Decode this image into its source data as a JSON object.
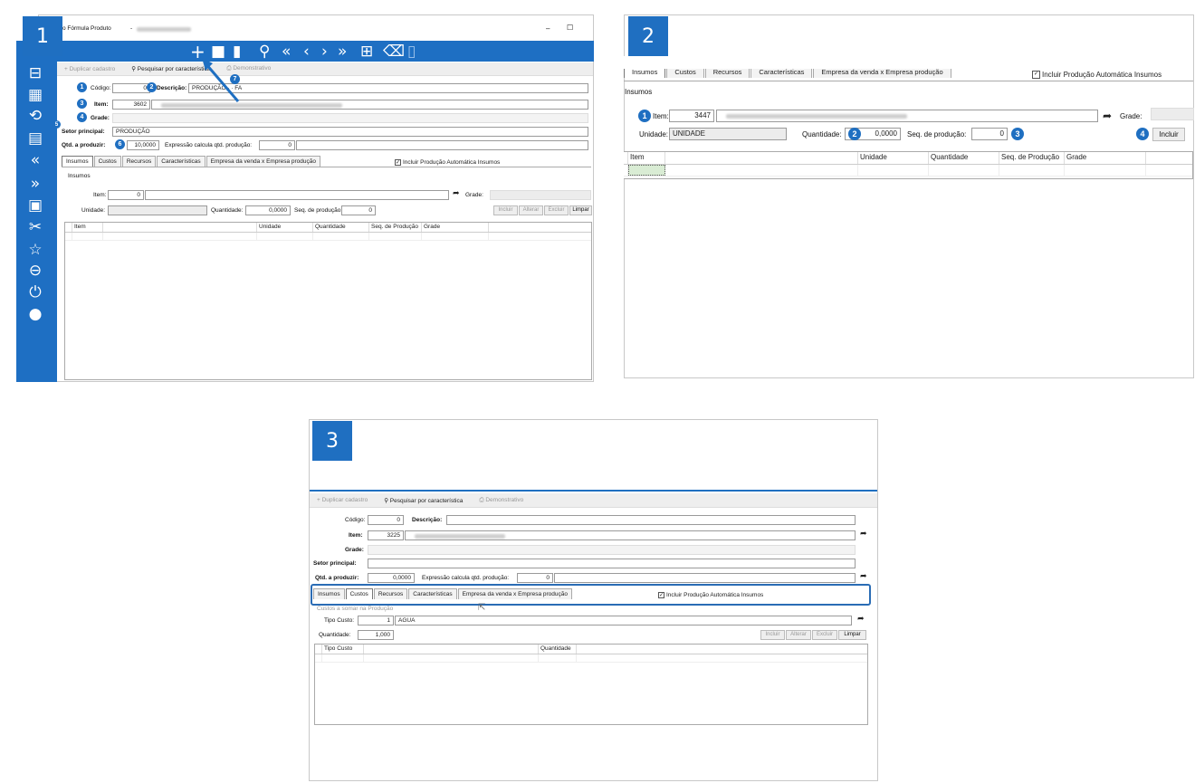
{
  "panels": [
    {
      "number": "1"
    },
    {
      "number": "2"
    },
    {
      "number": "3"
    }
  ],
  "p1": {
    "window_title": "tro Fórmula Produto",
    "title_sep": "-",
    "minimize": "–",
    "maximize": "☐",
    "subbar": {
      "duplicate": "Duplicar cadastro",
      "search": "Pesquisar por característica",
      "demo": "Demonstrativo"
    },
    "codigo_label": "Código:",
    "codigo_value": "0",
    "descricao_label": "Descrição:",
    "descricao_value": "PRODUÇÃO · · FA",
    "item_label": "Item:",
    "item_value": "3602",
    "grade_label": "Grade:",
    "setor_label": "Setor principal:",
    "setor_value": "PRODUÇÃO",
    "qtd_label": "Qtd. a produzir:",
    "qtd_value": "10,0000",
    "expr_label": "Expressão calcula qtd. produção:",
    "expr_value": "0",
    "tabs": [
      "Insumos",
      "Custos",
      "Recursos",
      "Características",
      "Empresa da venda x Empresa produção"
    ],
    "checkbox_label": "Incluir Produção Automática Insumos",
    "section_label": "Insumos",
    "ins_item_label": "Item:",
    "ins_item_value": "0",
    "ins_grade_label": "Grade:",
    "ins_unidade_label": "Unidade:",
    "ins_qtd_label": "Quantidade:",
    "ins_qtd_value": "0,0000",
    "ins_seq_label": "Seq. de produção:",
    "ins_seq_value": "0",
    "buttons": {
      "incluir": "Incluir",
      "alterar": "Alterar",
      "excluir": "Excluir",
      "limpar": "Limpar"
    },
    "grid_headers": [
      "Item",
      "Unidade",
      "Quantidade",
      "Seq. de Produção",
      "Grade"
    ],
    "callouts": [
      "1",
      "2",
      "3",
      "4",
      "5",
      "6",
      "7"
    ]
  },
  "p2": {
    "tabs": [
      "Insumos",
      "Custos",
      "Recursos",
      "Características",
      "Empresa da venda x Empresa produção"
    ],
    "checkbox_label": "Incluir Produção Automática Insumos",
    "section_label": "Insumos",
    "item_label": "Item:",
    "item_value": "3447",
    "grade_label": "Grade:",
    "unidade_label": "Unidade:",
    "unidade_value": "UNIDADE",
    "qtd_label": "Quantidade:",
    "qtd_value": "0,0000",
    "seq_label": "Seq. de produção:",
    "seq_value": "0",
    "incluir": "Incluir",
    "grid_headers": [
      "Item",
      "Unidade",
      "Quantidade",
      "Seq. de Produção",
      "Grade"
    ],
    "callouts": [
      "1",
      "2",
      "3",
      "4"
    ]
  },
  "p3": {
    "subbar": {
      "duplicate": "Duplicar cadastro",
      "search": "Pesquisar por característica",
      "demo": "Demonstrativo"
    },
    "codigo_label": "Código:",
    "codigo_value": "0",
    "descricao_label": "Descrição:",
    "item_label": "Item:",
    "item_value": "3225",
    "grade_label": "Grade:",
    "setor_label": "Setor principal:",
    "qtd_label": "Qtd. a produzir:",
    "qtd_value": "0,0000",
    "expr_label": "Expressão calcula qtd. produção:",
    "expr_value": "0",
    "tabs": [
      "Insumos",
      "Custos",
      "Recursos",
      "Características",
      "Empresa da venda x Empresa produção"
    ],
    "checkbox_label": "Incluir Produção Automática Insumos",
    "section_label": "Custos a somar na Produção",
    "tipo_label": "Tipo Custo:",
    "tipo_value": "1",
    "tipo_desc": "AGUA",
    "quantidade_label": "Quantidade:",
    "quantidade_value": "1,000",
    "buttons": {
      "incluir": "Incluir",
      "alterar": "Alterar",
      "excluir": "Excluir",
      "limpar": "Limpar"
    },
    "grid_headers": [
      "Tipo Custo",
      "Quantidade"
    ]
  },
  "colors": {
    "accent": "#1f6fc1",
    "highlight_border": "#2a6cb5"
  }
}
